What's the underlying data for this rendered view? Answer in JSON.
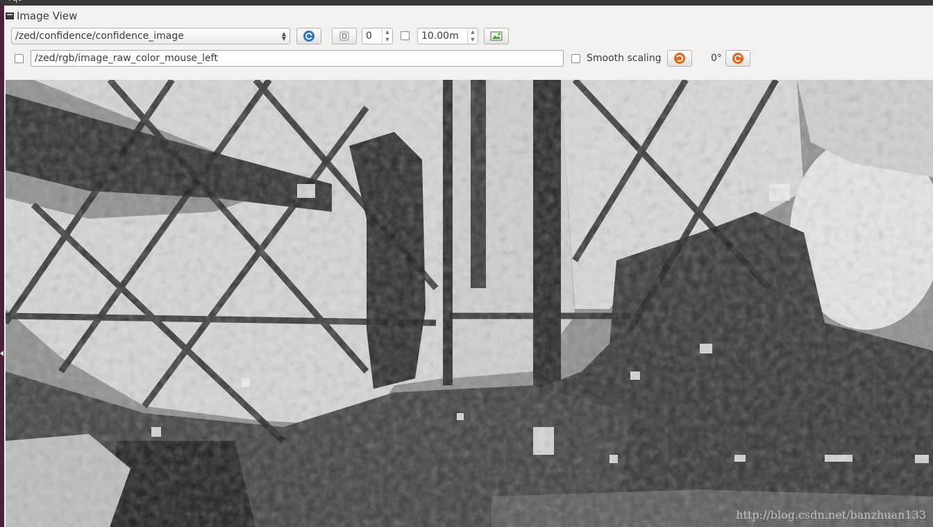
{
  "app_label": "rqt",
  "window": {
    "title": "Image View"
  },
  "toolbar1": {
    "topic_value": "/zed/confidence/confidence_image",
    "number_value": "0",
    "distance_value": "10.00m"
  },
  "toolbar2": {
    "click_topic_value": "/zed/rgb/image_raw_color_mouse_left",
    "smooth_scaling_label": "Smooth scaling",
    "rotation_value": "0°"
  },
  "image": {
    "watermark": "http://blog.csdn.net/banzhuan133"
  },
  "colors": {
    "refresh_icon": "#2e73c9",
    "rotate_icon": "#e2661c",
    "save_icon": "#3b9a3b"
  }
}
